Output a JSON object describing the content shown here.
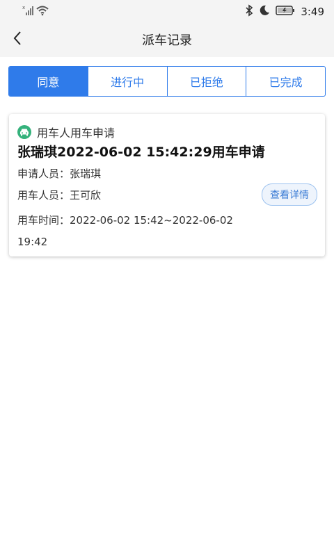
{
  "status_bar": {
    "time": "3:49",
    "icons": [
      "signal-icon",
      "wifi-icon",
      "bluetooth-icon",
      "moon-icon",
      "battery-icon"
    ]
  },
  "nav": {
    "title": "派车记录",
    "back_icon": "chevron-left-icon"
  },
  "tabs": [
    {
      "label": "同意",
      "active": true
    },
    {
      "label": "进行中",
      "active": false
    },
    {
      "label": "已拒绝",
      "active": false
    },
    {
      "label": "已完成",
      "active": false
    }
  ],
  "records": [
    {
      "type_label": "用车人用车申请",
      "type_icon": "car-icon",
      "title": "张瑞琪2022-06-02 15:42:29用车申请",
      "applicant_label": "申请人员：",
      "applicant": "张瑞琪",
      "user_label": "用车人员：",
      "user": "王可欣",
      "time_label": "用车时间：",
      "time_value": "2022-06-02 15:42~2022-06-02 19:42",
      "detail_button": "查看详情"
    }
  ],
  "colors": {
    "accent": "#2f7bea",
    "car_icon_bg": "#35b27c",
    "detail_button_bg": "#eef4fc"
  }
}
